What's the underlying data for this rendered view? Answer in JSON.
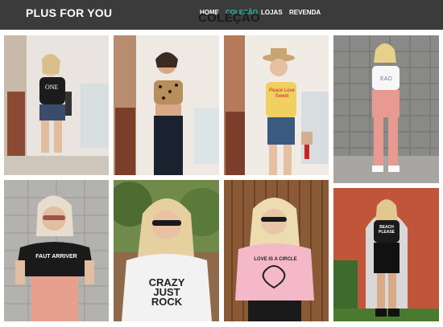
{
  "brand": {
    "name": "PLUS FOR YOU"
  },
  "nav": {
    "items": [
      {
        "label": "HOME",
        "active": false
      },
      {
        "label": "COLEÇÃO",
        "active": true
      },
      {
        "label": "LOJAS",
        "active": false
      },
      {
        "label": "REVENDA",
        "active": false
      }
    ],
    "overlay_title": "COLEÇÃO"
  },
  "colors": {
    "header_bg": "#3b3b3b",
    "accent": "#2bb6b0",
    "nav_text": "#ffffff"
  },
  "gallery": {
    "photos": [
      {
        "shirt_text": "ONE"
      },
      {
        "shirt_text": ""
      },
      {
        "shirt_text": "Peace Love Sweet"
      },
      {
        "shirt_text": ""
      },
      {
        "shirt_text": "FAUT ARRIVER"
      },
      {
        "shirt_text": "CRAZY JUST ROCK"
      },
      {
        "shirt_text": "LOVE IS A CIRCLE"
      },
      {
        "shirt_text": "BEACH PLEASE"
      }
    ]
  }
}
